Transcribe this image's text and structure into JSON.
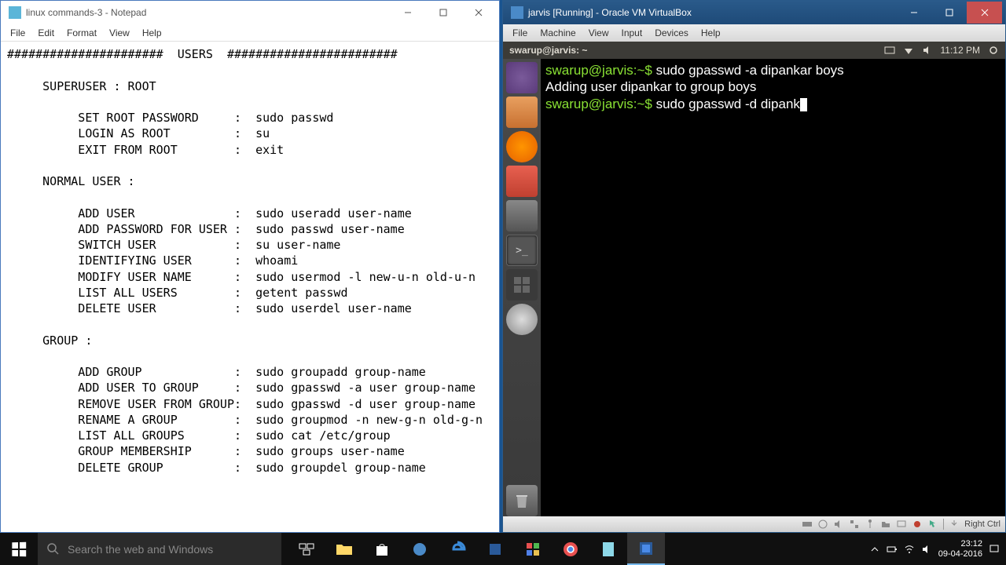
{
  "notepad": {
    "title": "linux commands-3 - Notepad",
    "menu": [
      "File",
      "Edit",
      "Format",
      "View",
      "Help"
    ],
    "content": "######################  USERS  ########################\n\n     SUPERUSER : ROOT\n\n          SET ROOT PASSWORD     :  sudo passwd\n          LOGIN AS ROOT         :  su\n          EXIT FROM ROOT        :  exit\n\n     NORMAL USER :\n\n          ADD USER              :  sudo useradd user-name\n          ADD PASSWORD FOR USER :  sudo passwd user-name\n          SWITCH USER           :  su user-name\n          IDENTIFYING USER      :  whoami\n          MODIFY USER NAME      :  sudo usermod -l new-u-n old-u-n\n          LIST ALL USERS        :  getent passwd\n          DELETE USER           :  sudo userdel user-name\n\n     GROUP :\n\n          ADD GROUP             :  sudo groupadd group-name\n          ADD USER TO GROUP     :  sudo gpasswd -a user group-name\n          REMOVE USER FROM GROUP:  sudo gpasswd -d user group-name\n          RENAME A GROUP        :  sudo groupmod -n new-g-n old-g-n\n          LIST ALL GROUPS       :  sudo cat /etc/group\n          GROUP MEMBERSHIP      :  sudo groups user-name\n          DELETE GROUP          :  sudo groupdel group-name"
  },
  "vbox": {
    "title": "jarvis [Running] - Oracle VM VirtualBox",
    "menu": [
      "File",
      "Machine",
      "View",
      "Input",
      "Devices",
      "Help"
    ],
    "guest_title": "swarup@jarvis: ~",
    "guest_time": "11:12 PM",
    "terminal": {
      "prompt": "swarup@jarvis:~$",
      "line1_cmd": "sudo gpasswd -a dipankar boys",
      "line2_out": "Adding user dipankar to group boys",
      "line3_cmd": "sudo gpasswd -d dipank"
    },
    "launcher": [
      "ubuntu-dash",
      "files",
      "firefox",
      "software-center",
      "system-settings",
      "terminal",
      "workspace-switcher",
      "disc",
      "trash"
    ],
    "status_hostkey": "Right Ctrl"
  },
  "taskbar": {
    "search_placeholder": "Search the web and Windows",
    "tray_time": "23:12",
    "tray_date": "09-04-2016",
    "apps": [
      "task-view",
      "file-explorer",
      "store",
      "snip",
      "edge",
      "vscode",
      "color-app",
      "chrome",
      "notepad",
      "virtualbox"
    ]
  }
}
